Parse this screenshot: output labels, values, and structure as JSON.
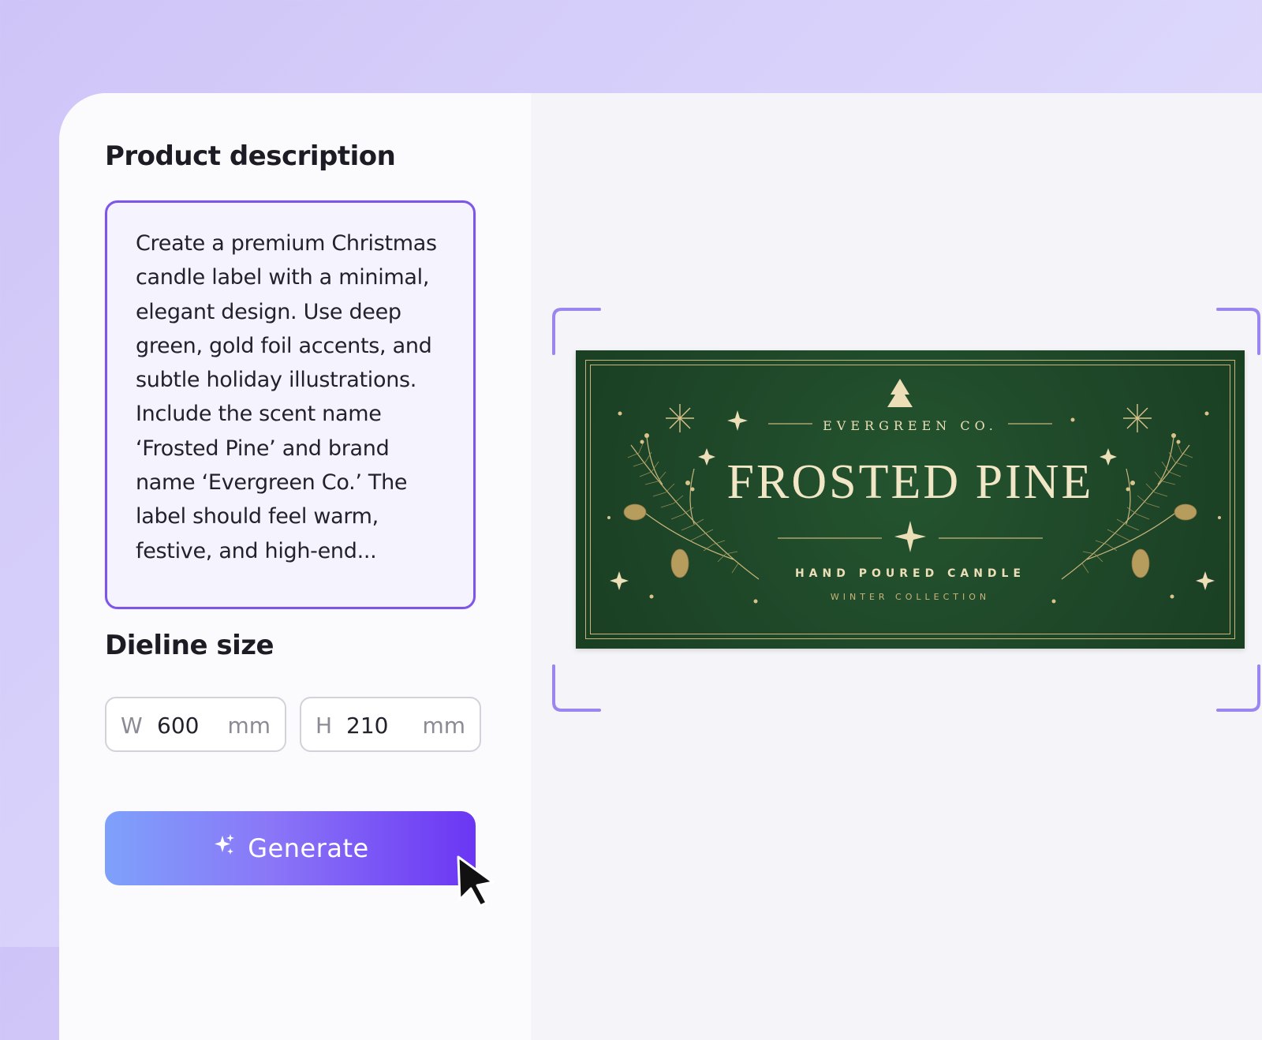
{
  "description_section": {
    "heading": "Product description",
    "text": "Create a premium Christmas candle label with a minimal, elegant design. Use deep green, gold foil accents, and subtle holiday illustrations. Include the scent name ‘Frosted Pine’ and brand name ‘Evergreen Co.’ The label should feel warm, festive, and high-end..."
  },
  "dieline": {
    "heading": "Dieline size",
    "width": {
      "axis": "W",
      "value": "600",
      "unit": "mm"
    },
    "height": {
      "axis": "H",
      "value": "210",
      "unit": "mm"
    }
  },
  "generate_button": {
    "label": "Generate",
    "icon": "sparkle-icon"
  },
  "preview_label": {
    "brand": "EVERGREEN CO.",
    "title": "FROSTED PINE",
    "subtitle": "HAND POURED CANDLE",
    "collection": "WINTER COLLECTION",
    "colors": {
      "background": "#1f4a29",
      "gold": "#c8b57a"
    }
  },
  "colors": {
    "accent": "#7d55e8",
    "button_gradient_start": "#7ea1fb",
    "button_gradient_end": "#6b36f4"
  }
}
